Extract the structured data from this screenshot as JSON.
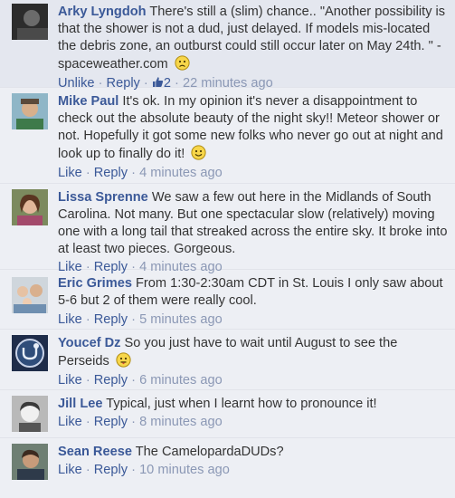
{
  "comments": [
    {
      "author": "Arky Lyngdoh",
      "text": "There's still a (slim) chance.. \"Another possibility is that the shower is not a dud, just delayed. If models mis-located the debris zone, an outburst could still occur later on May 24th. \" - spaceweather.com",
      "emoji": "sad-face-icon",
      "like_label": "Unlike",
      "reply_label": "Reply",
      "likes": "2",
      "time": "22 minutes ago"
    },
    {
      "author": "Mike Paul",
      "text": "It's ok. In my opinion it's never a disappointment to check out the absolute beauty of the night sky!! Meteor shower or not. Hopefully it got some new folks who never go out at night and look up to finally do it!",
      "emoji": "smile-face-icon",
      "like_label": "Like",
      "reply_label": "Reply",
      "time": "4 minutes ago"
    },
    {
      "author": "Lissa Sprenne",
      "text": "We saw a few out here in the Midlands of South Carolina. Not many. But one spectacular slow (relatively) moving one with a long tail that streaked across the entire sky. It broke into at least two pieces. Gorgeous.",
      "like_label": "Like",
      "reply_label": "Reply",
      "time": "4 minutes ago"
    },
    {
      "author": "Eric Grimes",
      "text": "From 1:30-2:30am CDT in St. Louis I only saw about 5-6 but 2 of them were really cool.",
      "like_label": "Like",
      "reply_label": "Reply",
      "time": "5 minutes ago"
    },
    {
      "author": "Youcef Dz",
      "text": "So you just have to wait until August to see the Perseids",
      "emoji": "tongue-face-icon",
      "like_label": "Like",
      "reply_label": "Reply",
      "time": "6 minutes ago"
    },
    {
      "author": "Jill Lee",
      "text": "Typical, just when I learnt how to pronounce it!",
      "like_label": "Like",
      "reply_label": "Reply",
      "time": "8 minutes ago"
    },
    {
      "author": "Sean Reese",
      "text": "The CamelopardaDUDs?",
      "like_label": "Like",
      "reply_label": "Reply",
      "time": "10 minutes ago"
    }
  ],
  "separator": " · ",
  "colors": {
    "link": "#3b5998",
    "muted": "#8b98b5",
    "background": "#edeff4"
  }
}
